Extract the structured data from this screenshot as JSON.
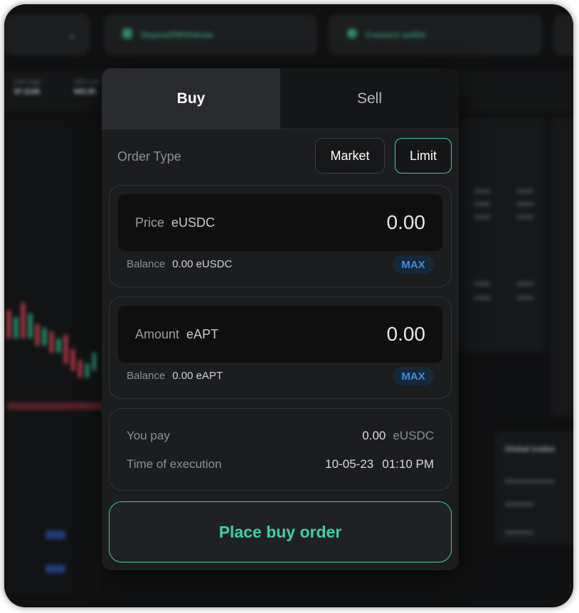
{
  "background": {
    "deposit_label": "Deposit/Withdraw",
    "connect_label": "Connect wallet",
    "stat_labels": [
      "24H High",
      "24H Low"
    ],
    "stat_values": [
      "97.3145",
      "945.95"
    ],
    "global_trades": "Global trades"
  },
  "tabs": {
    "buy": "Buy",
    "sell": "Sell"
  },
  "order_type": {
    "label": "Order Type",
    "market": "Market",
    "limit": "Limit"
  },
  "price": {
    "label": "Price",
    "unit": "eUSDC",
    "value": "0.00",
    "balance_label": "Balance",
    "balance_value": "0.00",
    "balance_unit": "eUSDC",
    "max": "MAX"
  },
  "amount": {
    "label": "Amount",
    "unit": "eAPT",
    "value": "0.00",
    "balance_label": "Balance",
    "balance_value": "0.00",
    "balance_unit": "eAPT",
    "max": "MAX"
  },
  "summary": {
    "pay_label": "You pay",
    "pay_value": "0.00",
    "pay_unit": "eUSDC",
    "time_label": "Time of execution",
    "time_date": "10-05-23",
    "time_clock": "01:10 PM"
  },
  "place_button": "Place buy order",
  "colors": {
    "accent": "#40cfa1",
    "max_text": "#3d8fe0",
    "modal_bg": "#1c1d1f",
    "page_bg": "#101112"
  }
}
